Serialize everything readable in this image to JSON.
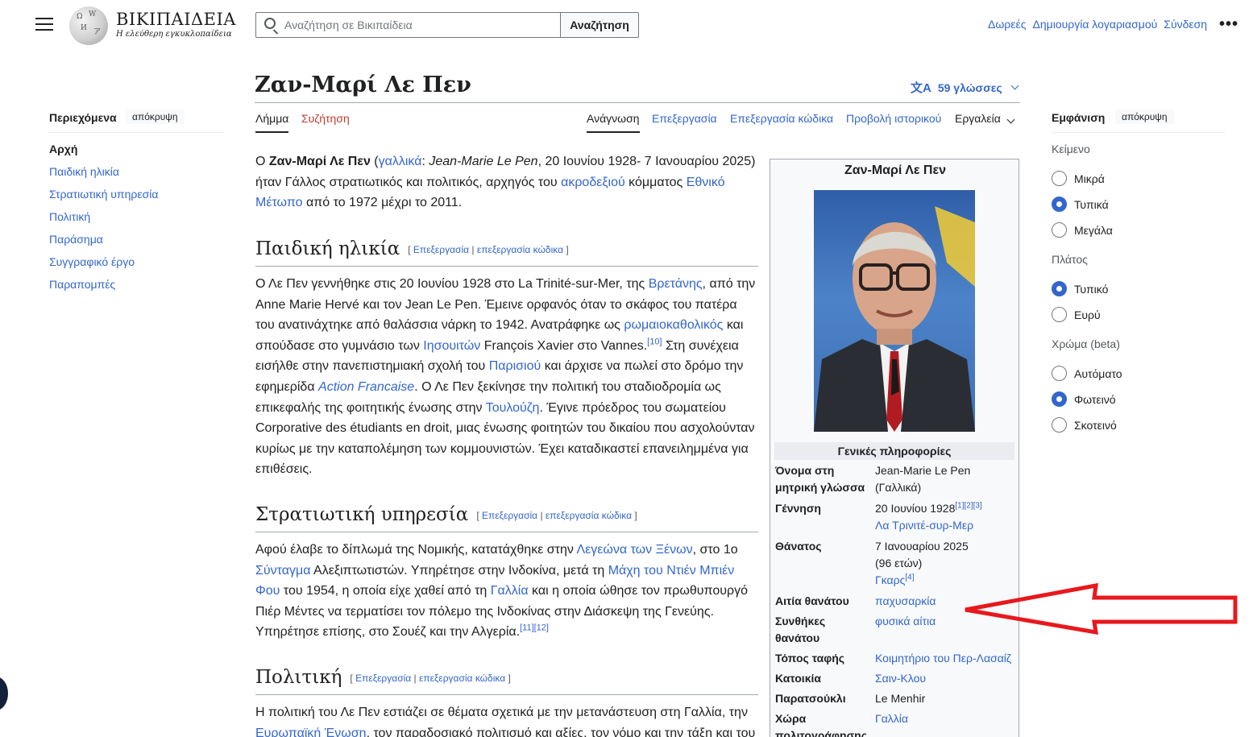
{
  "header": {
    "logo_word": "ΒΙΚΙΠΑΙΔΕΙΑ",
    "logo_tagline": "Η ελεύθερη εγκυκλοπαίδεια",
    "search_placeholder": "Αναζήτηση σε Βικιπαίδεια",
    "search_button": "Αναζήτηση",
    "user_links": [
      "Δωρεές",
      "Δημιουργία λογαριασμού",
      "Σύνδεση"
    ],
    "more": "•••"
  },
  "title": "Ζαν-Μαρί Λε Πεν",
  "languages": "59 γλώσσες",
  "tabs": {
    "article": "Λήμμα",
    "talk": "Συζήτηση",
    "read": "Ανάγνωση",
    "edit": "Επεξεργασία",
    "edit_source": "Επεξεργασία κώδικα",
    "history": "Προβολή ιστορικού",
    "tools": "Εργαλεία"
  },
  "toc": {
    "heading": "Περιεχόμενα",
    "hide": "απόκρυψη",
    "items": [
      "Αρχή",
      "Παιδική ηλικία",
      "Στρατιωτική υπηρεσία",
      "Πολιτική",
      "Παράσημα",
      "Συγγραφικό έργο",
      "Παραπομπές"
    ]
  },
  "sections": {
    "edit": "Επεξεργασία",
    "edit_source": "επεξεργασία κώδικα",
    "childhood": "Παιδική ηλικία",
    "military": "Στρατιωτική υπηρεσία",
    "politics": "Πολιτική"
  },
  "intro": {
    "l1a": "Ο ",
    "name": "Ζαν-Μαρί Λε Πεν",
    "l1b": " (",
    "french": "γαλλικά",
    "l1c": ": ",
    "native": "Jean-Marie Le Pen",
    "l1d": ", 20 Ιουνίου 1928- 7 Ιανουαρίου 2025)",
    "l2a": "ήταν Γάλλος στρατιωτικός και πολιτικός, αρχηγός του ",
    "far_right": "ακροδεξιού",
    "l2b": " κόμματος ",
    "front1": "Εθνικό",
    "front2": "Μέτωπο",
    "l3": " από το 1972 μέχρι το 2011."
  },
  "childhood": {
    "l1a": "Ο Λε Πεν γεννήθηκε στις 20 Ιουνίου 1928 στο La Trinité-sur-Mer, της ",
    "brittany": "Βρετάνης",
    "l1b": ", από την",
    "l2": "Anne Marie Hervé και τον Jean Le Pen. Έμεινε ορφανός όταν το σκάφος του πατέρα",
    "l3": "του ανατινάχτηκε από θαλάσσια νάρκη το 1942. Ανατράφηκε ως ",
    "catholic": "ρωμαιοκαθολικός",
    "l3b": " και",
    "l4a": "σπούδασε στο γυμνάσιο των ",
    "jesuits": "Ιησουιτών",
    "l4b": " François Xavier στο Vannes.",
    "ref10": "[10]",
    "l4c": " Στη συνέχεια",
    "l5a": "εισήλθε στην πανεπιστημιακή σχολή του ",
    "paris": "Παρισιού",
    "l5b": " και άρχισε να πωλεί στο δρόμο την",
    "l6a": "εφημερίδα ",
    "action": "Action Francaise",
    "l6b": ". Ο Λε Πεν ξεκίνησε την πολιτική του σταδιοδρομία ως",
    "l7a": "επικεφαλής της φοιτητικής ένωσης στην ",
    "toulouse": "Τουλούζη",
    "l7b": ". Έγινε πρόεδρος του σωματείου",
    "l8": "Corporative des étudiants en droit, μιας ένωσης φοιτητών του δικαίου που ασχολούνταν",
    "l9": "κυρίως με την καταπολέμηση των κομμουνιστών. Έχει καταδικαστεί επανειλημμένα για",
    "l10": "επιθέσεις."
  },
  "military": {
    "l1a": "Αφού έλαβε το δίπλωμά της Νομικής, κατατάχθηκε στην ",
    "legion": "Λεγεώνα των Ξένων",
    "l1b": ", στο 1ο",
    "regiment": "Σύνταγμα",
    "l2b": " Αλεξιπτωτιστών. Υπηρέτησε στην Ινδοκίνα, μετά τη ",
    "dien1": "Μάχη του Ντιέν Μπιέν",
    "dien2": "Φου",
    "l3b": " του 1954, η οποία είχε χαθεί από τη ",
    "france": "Γαλλία",
    "l3c": " και η οποία ώθησε τον πρωθυπουργό",
    "l4": "Πιέρ Μέντες να τερματίσει τον πόλεμο της Ινδοκίνας στην Διάσκεψη της Γενεύης.",
    "l5": "Υπηρέτησε επίσης, στο Σουέζ και την Αλγερία.",
    "ref": "[11][12]"
  },
  "politics": {
    "l1": "Η πολιτική του Λε Πεν εστιάζει σε θέματα σχετικά με την μετανάστευση στη Γαλλία, την",
    "eu": "Ευρωπαϊκή Ένωση",
    "l2b": ", τον παραδοσιακό πολιτισμό και αξίες, τον νόμο και την τάξη και του"
  },
  "infobox": {
    "title": "Ζαν-Μαρί Λε Πεν",
    "section": "Γενικές πληροφορίες",
    "native_label1": "Όνομα στη",
    "native_label2": "μητρική γλώσσα",
    "native_v1": "Jean-Marie Le Pen",
    "native_v2": "(Γαλλικά)",
    "birth_label": "Γέννηση",
    "birth_date": "20  Ιουνίου 1928",
    "birth_refs": "[1][2][3]",
    "birth_place": "Λα Τρινιτέ-συρ-Μερ",
    "death_label": "Θάνατος",
    "death_date": "7 Ιανουαρίου 2025",
    "death_age": "(96 ετών)",
    "death_place": "Γκαρς",
    "death_ref": "[4]",
    "cause_label": "Αιτία θανάτου",
    "cause_value": "παχυσαρκία",
    "circ_label1": "Συνθήκες",
    "circ_label2": "θανάτου",
    "circ_value": "φυσικά αίτια",
    "burial_label": "Τόπος ταφής",
    "burial_value": "Κοιμητήριο του Περ-Λασαίζ",
    "residence_label": "Κατοικία",
    "residence_value": "Σαιν-Κλου",
    "nick_label": "Παρατσούκλι",
    "nick_value": "Le Menhir",
    "country_label1": "Χώρα",
    "country_label2": "πολιτογράφησης",
    "country_value": "Γαλλία"
  },
  "appearance": {
    "heading": "Εμφάνιση",
    "hide": "απόκρυψη",
    "text_label": "Κείμενο",
    "text_options": [
      "Μικρά",
      "Τυπικά",
      "Μεγάλα"
    ],
    "text_selected": "Τυπικά",
    "width_label": "Πλάτος",
    "width_options": [
      "Τυπικό",
      "Ευρύ"
    ],
    "width_selected": "Τυπικό",
    "color_label": "Χρώμα (beta)",
    "color_options": [
      "Αυτόματο",
      "Φωτεινό",
      "Σκοτεινό"
    ],
    "color_selected": "Φωτεινό"
  },
  "colors": {
    "link": "#3366cc",
    "talk": "#bf3c2c",
    "annotation_arrow": "#e8181c"
  }
}
